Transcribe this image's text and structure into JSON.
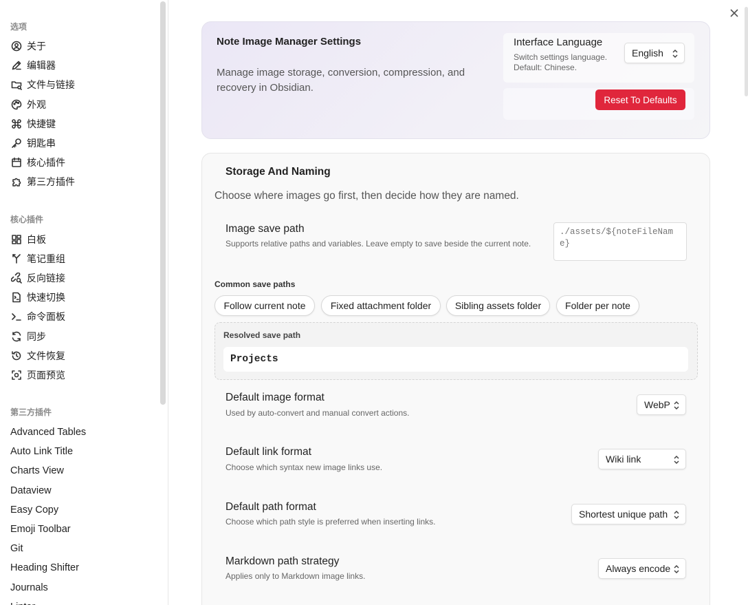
{
  "sidebar": {
    "options_heading": "选项",
    "options": [
      {
        "label": "关于",
        "icon": "user-circle-icon"
      },
      {
        "label": "编辑器",
        "icon": "pencil-icon"
      },
      {
        "label": "文件与链接",
        "icon": "folder-icon"
      },
      {
        "label": "外观",
        "icon": "palette-icon"
      },
      {
        "label": "快捷键",
        "icon": "command-icon"
      },
      {
        "label": "钥匙串",
        "icon": "key-icon"
      },
      {
        "label": "核心插件",
        "icon": "calendar-icon"
      },
      {
        "label": "第三方插件",
        "icon": "puzzle-icon"
      }
    ],
    "core_heading": "核心插件",
    "core": [
      {
        "label": "白板",
        "icon": "grid-icon"
      },
      {
        "label": "笔记重组",
        "icon": "merge-icon"
      },
      {
        "label": "反向链接",
        "icon": "link-search-icon"
      },
      {
        "label": "快速切换",
        "icon": "file-switch-icon"
      },
      {
        "label": "命令面板",
        "icon": "terminal-icon"
      },
      {
        "label": "同步",
        "icon": "sync-icon"
      },
      {
        "label": "文件恢复",
        "icon": "history-icon"
      },
      {
        "label": "页面预览",
        "icon": "preview-icon"
      }
    ],
    "third_heading": "第三方插件",
    "third": [
      "Advanced Tables",
      "Auto Link Title",
      "Charts View",
      "Dataview",
      "Easy Copy",
      "Emoji Toolbar",
      "Git",
      "Heading Shifter",
      "Journals",
      "Linter"
    ]
  },
  "hero": {
    "title": "Note Image Manager Settings",
    "description": "Manage image storage, conversion, compression, and recovery in Obsidian.",
    "language_title": "Interface Language",
    "language_sub_1": "Switch settings language.",
    "language_sub_2": "Default: Chinese.",
    "language_value": "English",
    "reset_label": "Reset To Defaults"
  },
  "storage": {
    "title": "Storage And Naming",
    "description": "Choose where images go first, then decide how they are named.",
    "save_path_title": "Image save path",
    "save_path_sub": "Supports relative paths and variables. Leave empty to save beside the current note.",
    "save_path_placeholder": "./assets/${noteFileName}",
    "common_label": "Common save paths",
    "chips": [
      "Follow current note",
      "Fixed attachment folder",
      "Sibling assets folder",
      "Folder per note"
    ],
    "resolved_label": "Resolved save path",
    "resolved_value": "Projects",
    "format_title": "Default image format",
    "format_sub": "Used by auto-convert and manual convert actions.",
    "format_value": "WebP",
    "link_title": "Default link format",
    "link_sub": "Choose which syntax new image links use.",
    "link_value": "Wiki link",
    "pathfmt_title": "Default path format",
    "pathfmt_sub": "Choose which path style is preferred when inserting links.",
    "pathfmt_value": "Shortest unique path",
    "md_title": "Markdown path strategy",
    "md_sub": "Applies only to Markdown image links.",
    "md_value": "Always encode"
  },
  "colors": {
    "accent_red": "#e0263c",
    "hero_gradient": "#ebe7f6"
  }
}
